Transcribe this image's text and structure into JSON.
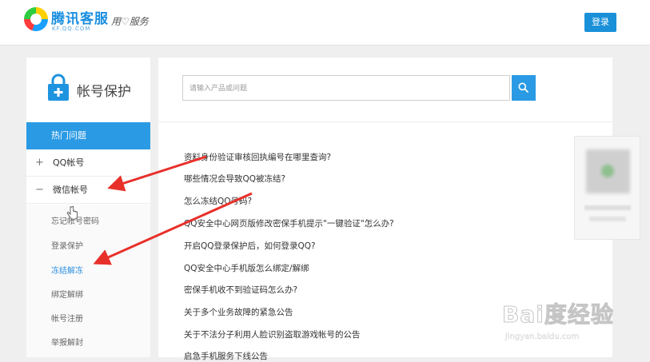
{
  "header": {
    "brand_name": "腾讯客服",
    "brand_domain": "KF.QQ.COM",
    "slogan": "用♡服务",
    "login_label": "登录"
  },
  "sidebar": {
    "title": "帐号保护",
    "hot_label": "热门问题",
    "categories": [
      {
        "toggle": "+",
        "label": "QQ帐号"
      },
      {
        "toggle": "−",
        "label": "微信帐号"
      }
    ],
    "sub_items": [
      "忘记帐号密码",
      "登录保护",
      "冻结解冻",
      "绑定解绑",
      "帐号注册",
      "举报解封"
    ],
    "active_sub_index": 2
  },
  "search": {
    "placeholder": "请输入产品或问题"
  },
  "questions": [
    "资料身份验证审核回执编号在哪里查询?",
    "哪些情况会导致QQ被冻结?",
    "怎么冻结QQ号码?",
    "QQ安全中心网页版修改密保手机提示\"一键验证\"怎么办?",
    "开启QQ登录保护后，如何登录QQ?",
    "QQ安全中心手机版怎么绑定/解绑",
    "密保手机收不到验证码怎么办?",
    "关于多个业务故障的紧急公告",
    "关于不法分子利用人脸识别盗取游戏帐号的公告",
    "启急手机服务下线公告"
  ],
  "watermark": {
    "logo": "Bai度经验",
    "url": "jingyan.baidu.com"
  },
  "colors": {
    "accent": "#2b9ae4",
    "annotation_arrow": "#e8302a",
    "brand": "#1a8ee0"
  }
}
